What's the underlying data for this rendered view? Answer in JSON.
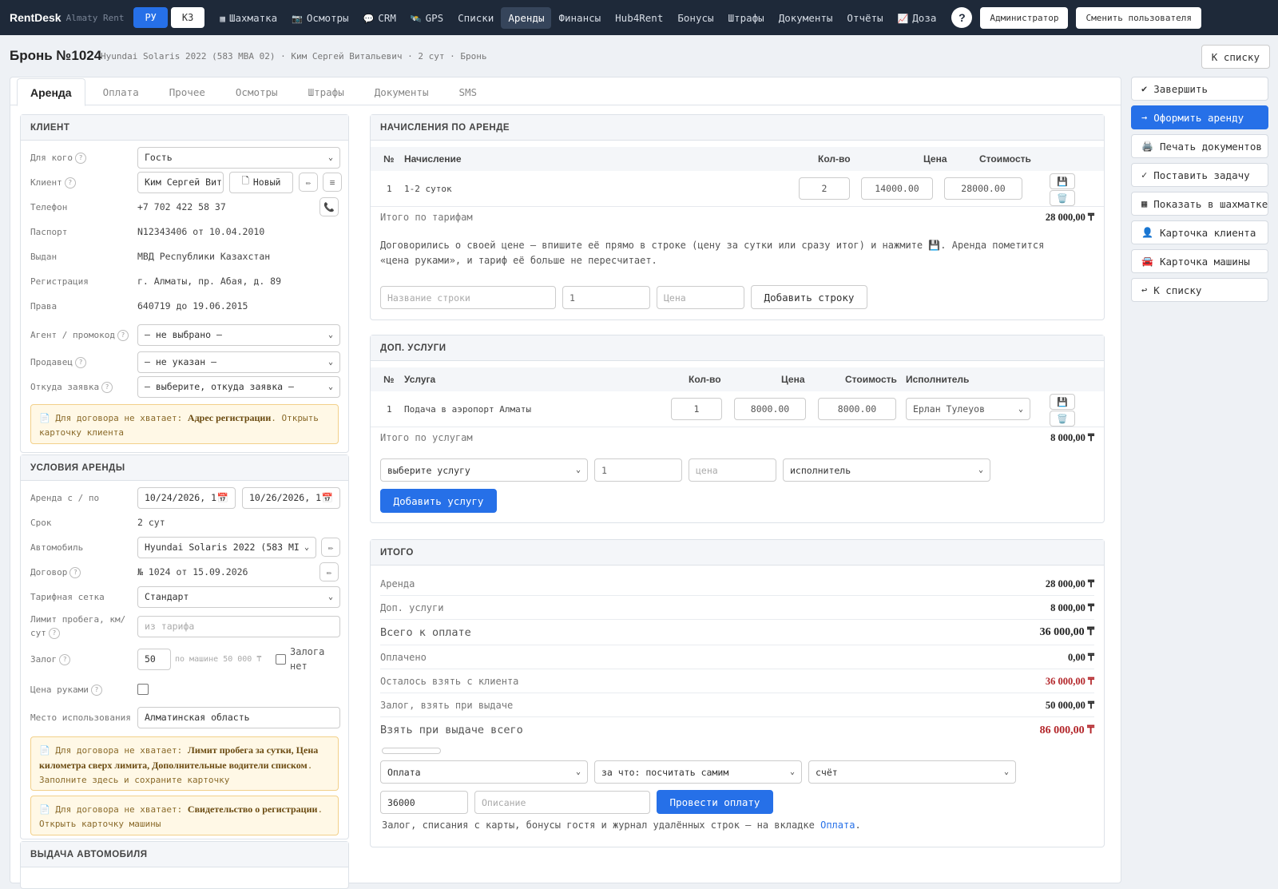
{
  "topbar": {
    "brand": "RentDesk",
    "brand_sub": "Almaty Rent",
    "lang_ru": "РУ",
    "lang_kz": "КЗ",
    "nav": [
      {
        "label": "Шахматка",
        "icon": "▦"
      },
      {
        "label": "Осмотры",
        "icon": "📷"
      },
      {
        "label": "CRM",
        "icon": "💬"
      },
      {
        "label": "GPS",
        "icon": "🛰️"
      },
      {
        "label": "Списки",
        "icon": ""
      },
      {
        "label": "Аренды",
        "icon": ""
      },
      {
        "label": "Финансы",
        "icon": ""
      },
      {
        "label": "Hub4Rent",
        "icon": ""
      },
      {
        "label": "Бонусы",
        "icon": ""
      },
      {
        "label": "Штрафы",
        "icon": ""
      },
      {
        "label": "Документы",
        "icon": ""
      },
      {
        "label": "Отчёты",
        "icon": ""
      },
      {
        "label": "Доза",
        "icon": "📈"
      }
    ],
    "help": "?",
    "admin_label": "Администратор",
    "switch_user_label": "Сменить пользователя"
  },
  "header": {
    "title": "Бронь №1024",
    "subtitle": "Hyundai Solaris 2022 (583 MBA 02) · Ким Сергей Витальевич · 2 сут · Бронь",
    "back_label": "К списку"
  },
  "tabs": [
    "Аренда",
    "Оплата",
    "Прочее",
    "Осмотры",
    "Штрафы",
    "Документы",
    "SMS"
  ],
  "client": {
    "title": "КЛИЕНТ",
    "for_whom_label": "Для кого",
    "for_whom_value": "Гость",
    "client_label": "Клиент",
    "client_value": "Ким Сергей Вит",
    "new_label": "Новый",
    "phone_label": "Телефон",
    "phone_value": "+7 702 422 58 37",
    "passport_label": "Паспорт",
    "passport_value": "N12343406 от 10.04.2010",
    "issued_label": "Выдан",
    "issued_value": "МВД Республики Казахстан",
    "reg_label": "Регистрация",
    "reg_value": "г. Алматы, пр. Абая, д. 89",
    "license_label": "Права",
    "license_value": "640719 до 19.06.2015",
    "agent_label": "Агент / промокод",
    "agent_value": "— не выбрано —",
    "seller_label": "Продавец",
    "seller_value": "— не указан —",
    "source_label": "Откуда заявка",
    "source_value": "— выберите, откуда заявка —",
    "warn_prefix": "Для договора не хватает:",
    "warn_missing": "Адрес регистрации",
    "warn_link": "Открыть карточку клиента"
  },
  "terms": {
    "title": "УСЛОВИЯ АРЕНДЫ",
    "period_label": "Аренда с / по",
    "date_from": "10/24/2026, 1",
    "date_to": "10/26/2026, 1",
    "term_label": "Срок",
    "term_value": "2 сут",
    "car_label": "Автомобиль",
    "car_value": "Hyundai Solaris 2022 (583 MI",
    "contract_label": "Договор",
    "contract_value": "№ 1024 от 15.09.2026",
    "tariff_label": "Тарифная сетка",
    "tariff_value": "Стандарт",
    "mileage_label": "Лимит пробега, км/сут",
    "mileage_placeholder": "из тарифа",
    "deposit_label": "Залог",
    "deposit_value": "50",
    "deposit_hint": "по машине 50 000 ₸",
    "no_deposit_label": "Залога нет",
    "manual_price_label": "Цена руками",
    "place_label": "Место использования",
    "place_value": "Алматинская область",
    "warn1_prefix": "Для договора не хватает:",
    "warn1_missing": "Лимит пробега за сутки, Цена километра сверх лимита, Дополнительные водители списком",
    "warn1_hint": "Заполните здесь и сохраните карточку",
    "warn2_prefix": "Для договора не хватает:",
    "warn2_missing": "Свидетельство о регистрации",
    "warn2_link": "Открыть карточку машины"
  },
  "delivery": {
    "title": "ВЫДАЧА АВТОМОБИЛЯ"
  },
  "charges": {
    "title": "НАЧИСЛЕНИЯ ПО АРЕНДЕ",
    "headers": {
      "no": "№",
      "name": "Начисление",
      "qty": "Кол-во",
      "price": "Цена",
      "cost": "Стоимость"
    },
    "rows": [
      {
        "no": "1",
        "name": "1-2 суток",
        "qty": "2",
        "price": "14000.00",
        "cost": "28000.00"
      }
    ],
    "total_label": "Итого по тарифам",
    "total_value": "28 000,00 ₸",
    "hint": "Договорились о своей цене — впишите её прямо в строке (цену за сутки или сразу итог) и нажмите 💾. Аренда пометится «цена руками», и тариф её больше не пересчитает.",
    "new_name_placeholder": "Название строки",
    "new_qty": "1",
    "new_price_placeholder": "Цена",
    "add_label": "Добавить строку"
  },
  "services": {
    "title": "ДОП. УСЛУГИ",
    "headers": {
      "no": "№",
      "name": "Услуга",
      "qty": "Кол-во",
      "price": "Цена",
      "cost": "Стоимость",
      "executor": "Исполнитель"
    },
    "rows": [
      {
        "no": "1",
        "name": "Подача в аэропорт Алматы",
        "qty": "1",
        "price": "8000.00",
        "cost": "8000.00",
        "executor": "Ерлан Тулеуов"
      }
    ],
    "total_label": "Итого по услугам",
    "total_value": "8 000,00 ₸",
    "select_placeholder": "выберите услугу",
    "new_qty": "1",
    "price_placeholder": "цена",
    "executor_placeholder": "исполнитель",
    "add_label": "Добавить услугу"
  },
  "totals": {
    "title": "ИТОГО",
    "rent_label": "Аренда",
    "rent_value": "28 000,00 ₸",
    "services_label": "Доп. услуги",
    "services_value": "8 000,00 ₸",
    "total_label": "Всего к оплате",
    "total_value": "36 000,00 ₸",
    "paid_label": "Оплачено",
    "paid_value": "0,00 ₸",
    "remaining_label": "Осталось взять с клиента",
    "remaining_value": "36 000,00 ₸",
    "deposit_label": "Залог, взять при выдаче",
    "deposit_value": "50 000,00 ₸",
    "grand_label": "Взять при выдаче всего",
    "grand_value": "86 000,00 ₸",
    "pay_type": "Оплата",
    "pay_for": "за что: посчитать самим",
    "pay_account": "счёт",
    "pay_amount": "36000",
    "pay_desc_placeholder": "Описание",
    "pay_button": "Провести оплату",
    "note_text": "Залог, списания с карты, бонусы гостя и журнал удалённых строк — на вкладке",
    "note_link": "Оплата"
  },
  "actions": [
    {
      "label": "Завершить",
      "icon": "✔"
    },
    {
      "label": "Оформить аренду",
      "icon": "→"
    },
    {
      "label": "Печать документов",
      "icon": "🖨️"
    },
    {
      "label": "Поставить задачу",
      "icon": "✓"
    },
    {
      "label": "Показать в шахматке",
      "icon": "▦"
    },
    {
      "label": "Карточка клиента",
      "icon": "👤"
    },
    {
      "label": "Карточка машины",
      "icon": "🚘"
    },
    {
      "label": "К списку",
      "icon": "↩"
    }
  ]
}
